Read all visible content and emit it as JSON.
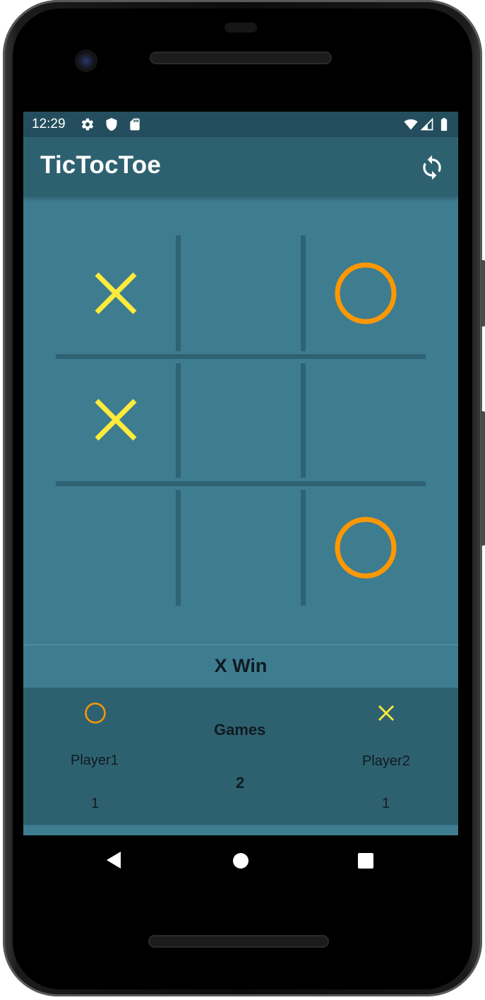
{
  "status_bar": {
    "time": "12:29",
    "left_icons": [
      "gear-icon",
      "shield-icon",
      "sd-card-icon"
    ],
    "right_icons": [
      "wifi-icon",
      "cell-signal-icon",
      "battery-icon"
    ]
  },
  "app_bar": {
    "title": "TicTocToe",
    "action_icon": "refresh-icon"
  },
  "board": {
    "cells": [
      "X",
      "",
      "O",
      "X",
      "",
      "",
      "",
      "",
      "O"
    ],
    "x_color": "#ffeb3b",
    "o_color": "#ff9800",
    "line_color": "#2d6373"
  },
  "game_status": "X Win",
  "score": {
    "player1": {
      "name": "Player1",
      "symbol": "O",
      "wins": "1"
    },
    "games": {
      "label": "Games",
      "count": "2"
    },
    "player2": {
      "name": "Player2",
      "symbol": "X",
      "wins": "1"
    }
  },
  "nav_bar": {
    "icons": [
      "back-icon",
      "home-icon",
      "recents-icon"
    ]
  },
  "colors": {
    "status_bar": "#244e5d",
    "app_bar": "#2e6170",
    "background": "#3e7c90",
    "score_panel": "#2e6170"
  }
}
